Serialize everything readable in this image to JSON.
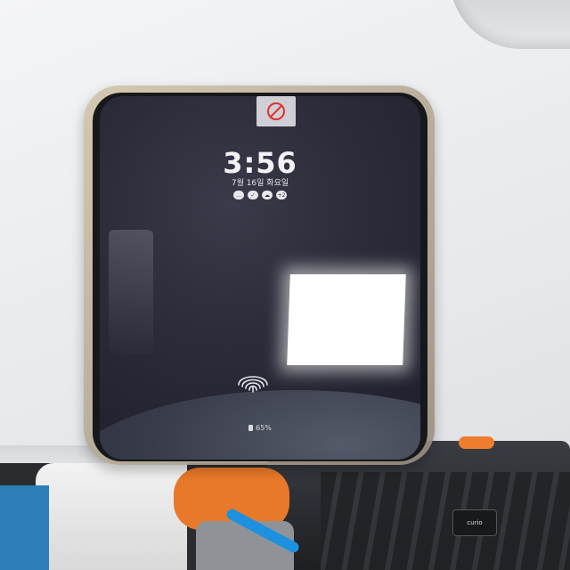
{
  "lock_screen": {
    "time": "3:56",
    "date": "7월 16일 화요일",
    "battery": "65%",
    "notification_icons": [
      "chat-icon",
      "check-icon",
      "cloud-icon",
      "count-badge"
    ],
    "notification_badge": "+2"
  },
  "colors": {
    "screen_background": "#2c2c3a",
    "case": "#b8aa90",
    "accent_orange": "#e9792a",
    "accent_blue": "#2c7fb8"
  },
  "bottom_tag_text": "curio"
}
